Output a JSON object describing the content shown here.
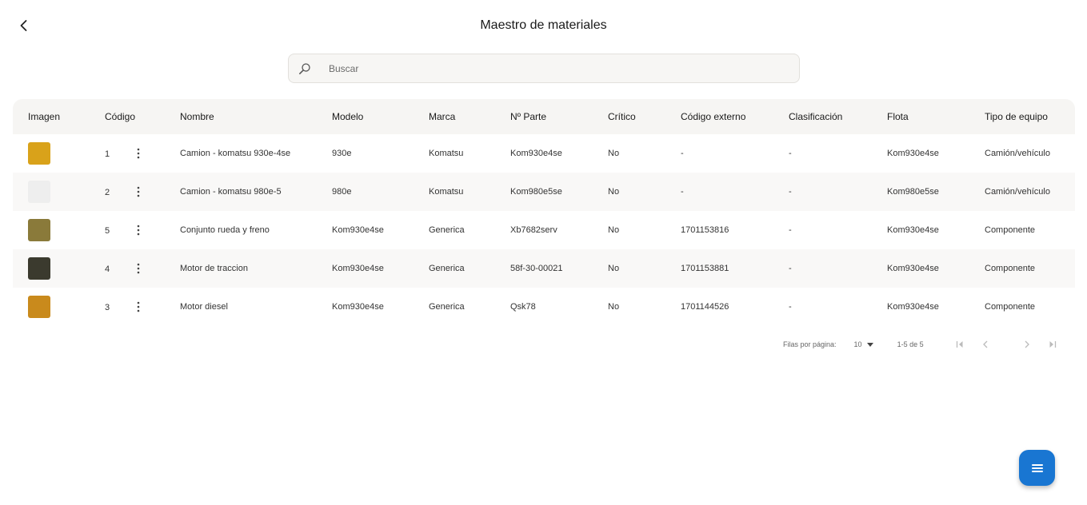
{
  "header": {
    "title": "Maestro de materiales",
    "back_icon": "arrow-back-icon"
  },
  "search": {
    "placeholder": "Buscar",
    "value": "",
    "icon": "search-icon"
  },
  "table": {
    "columns": [
      "Imagen",
      "Código",
      "Nombre",
      "Modelo",
      "Marca",
      "Nº Parte",
      "Crítico",
      "Código externo",
      "Clasificación",
      "Flota",
      "Tipo de equipo"
    ],
    "rows": [
      {
        "codigo": "1",
        "nombre": "Camion - komatsu 930e-4se",
        "modelo": "930e",
        "marca": "Komatsu",
        "parte": "Kom930e4se",
        "critico": "No",
        "externo": "-",
        "clasificacion": "-",
        "flota": "Kom930e4se",
        "tipo": "Camión/vehículo",
        "image": "haul-truck-thumbnail",
        "thumb_color": "#d9a21a"
      },
      {
        "codigo": "2",
        "nombre": "Camion - komatsu 980e-5",
        "modelo": "980e",
        "marca": "Komatsu",
        "parte": "Kom980e5se",
        "critico": "No",
        "externo": "-",
        "clasificacion": "-",
        "flota": "Kom980e5se",
        "tipo": "Camión/vehículo",
        "image": "image-placeholder-thumbnail",
        "thumb_color": "#eeeeee"
      },
      {
        "codigo": "5",
        "nombre": "Conjunto rueda y freno",
        "modelo": "Kom930e4se",
        "marca": "Generica",
        "parte": "Xb7682serv",
        "critico": "No",
        "externo": "1701153816",
        "clasificacion": "-",
        "flota": "Kom930e4se",
        "tipo": "Componente",
        "image": "wheel-brake-thumbnail",
        "thumb_color": "#8a7a3a"
      },
      {
        "codigo": "4",
        "nombre": "Motor de traccion",
        "modelo": "Kom930e4se",
        "marca": "Generica",
        "parte": "58f-30-00021",
        "critico": "No",
        "externo": "1701153881",
        "clasificacion": "-",
        "flota": "Kom930e4se",
        "tipo": "Componente",
        "image": "traction-motor-thumbnail",
        "thumb_color": "#3b3a2e"
      },
      {
        "codigo": "3",
        "nombre": "Motor diesel",
        "modelo": "Kom930e4se",
        "marca": "Generica",
        "parte": "Qsk78",
        "critico": "No",
        "externo": "1701144526",
        "clasificacion": "-",
        "flota": "Kom930e4se",
        "tipo": "Componente",
        "image": "diesel-engine-thumbnail",
        "thumb_color": "#c98a1c"
      }
    ]
  },
  "pagination": {
    "rows_per_page_label": "Filas por página:",
    "rows_per_page_value": "10",
    "range_label": "1-5 de 5"
  },
  "fab": {
    "icon": "menu-icon",
    "color": "#1976d2"
  }
}
